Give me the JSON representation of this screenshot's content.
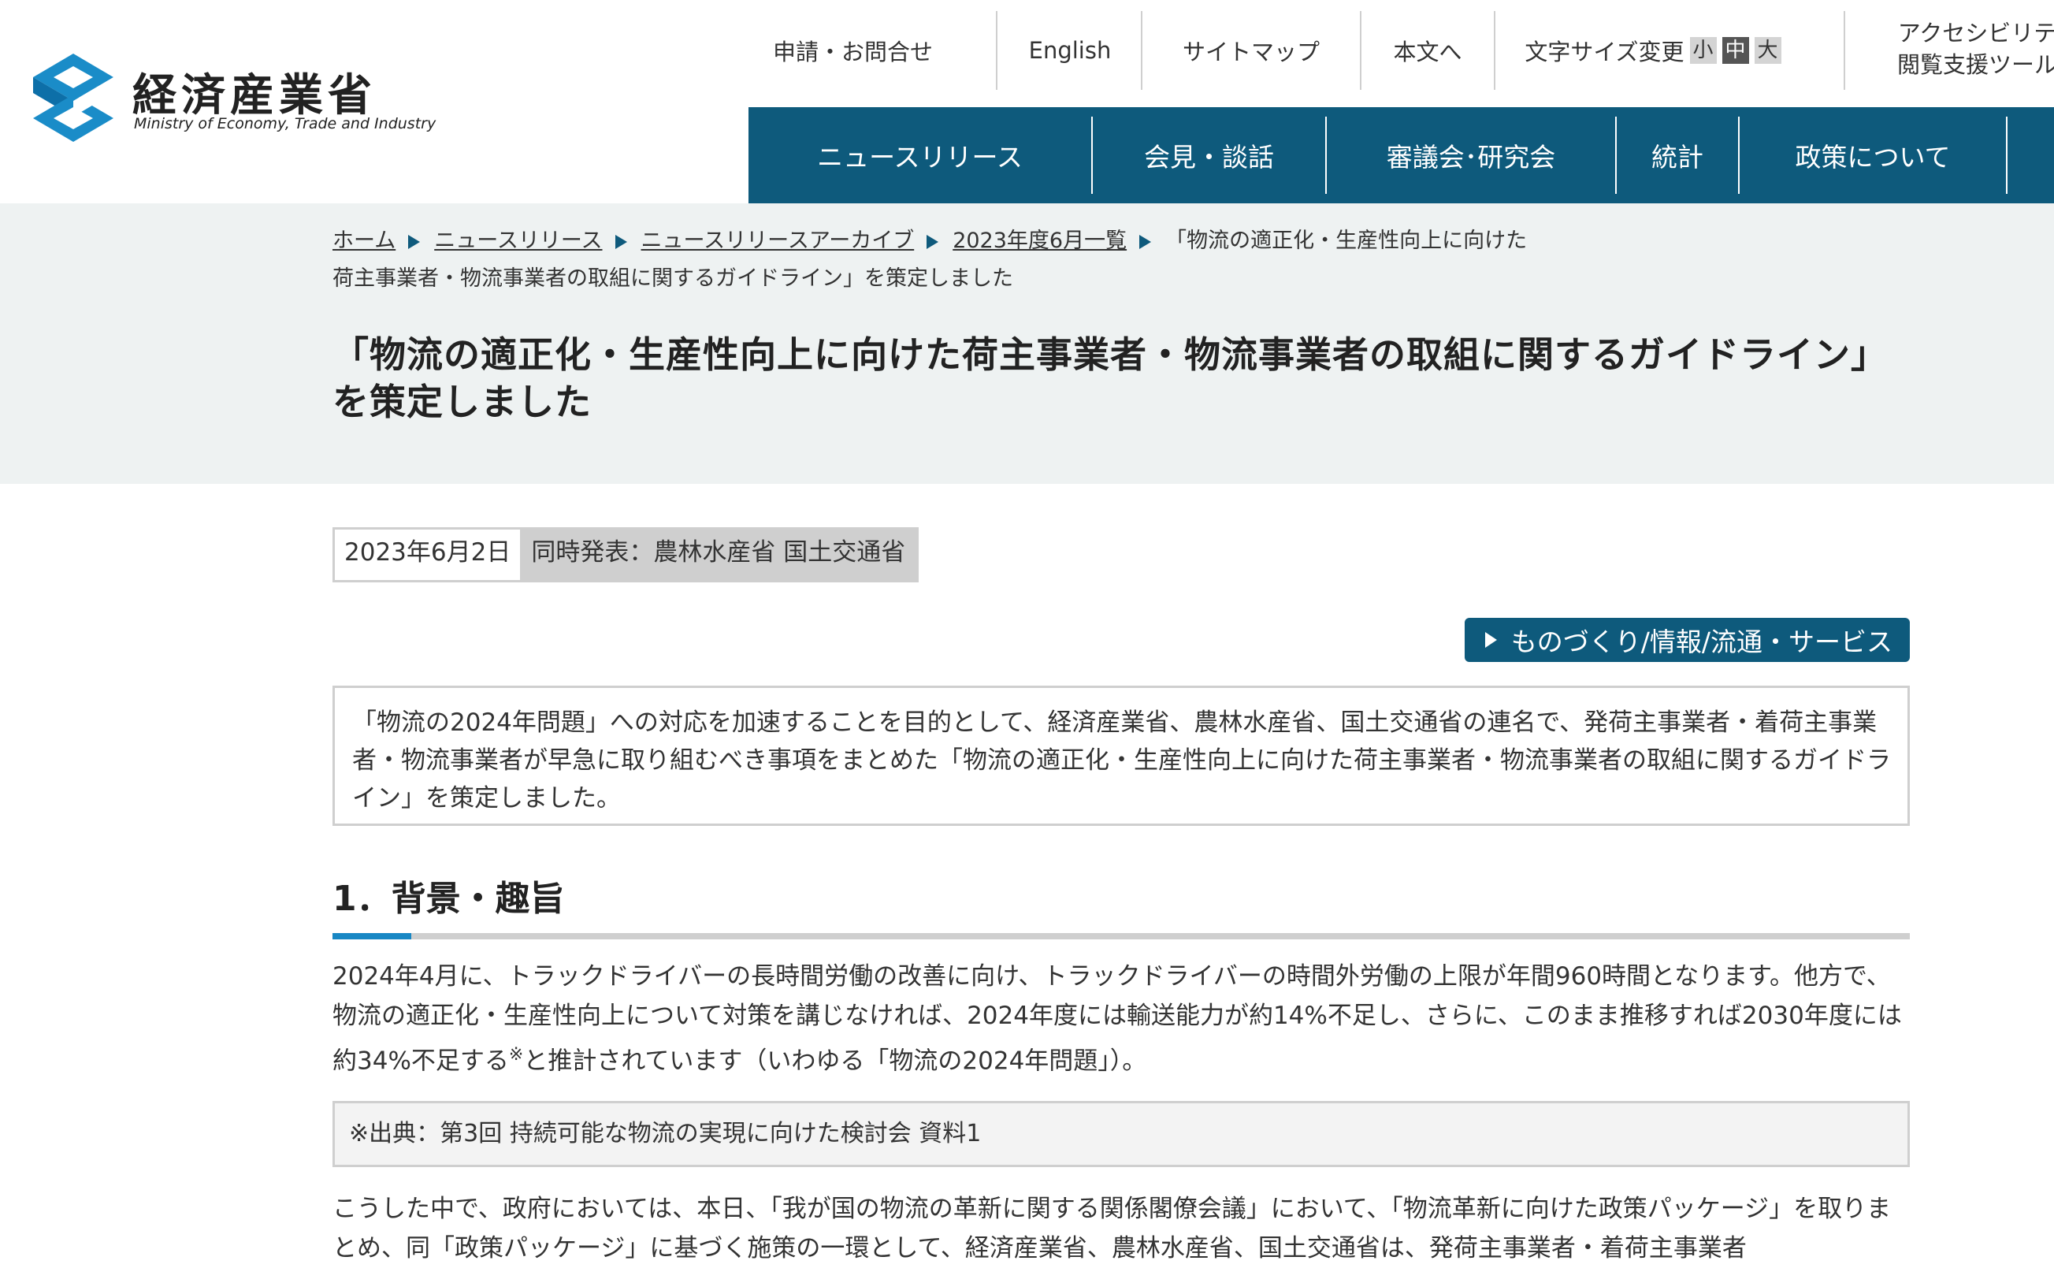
{
  "header": {
    "logo_ja": "経済産業省",
    "logo_en": "Ministry of Economy, Trade and Industry",
    "utility": {
      "contact": "申請・お問合せ",
      "english": "English",
      "sitemap": "サイトマップ",
      "to_content": "本文へ",
      "font_size_label": "文字サイズ変更",
      "font_small": "小",
      "font_mid": "中",
      "font_large": "大",
      "accessibility_line1": "アクセシビリテ",
      "accessibility_line2": "閲覧支援ツール"
    },
    "nav": [
      "ニュースリリース",
      "会見・談話",
      "審議会･研究会",
      "統計",
      "政策について"
    ]
  },
  "breadcrumb": {
    "home": "ホーム",
    "news": "ニュースリリース",
    "archive": "ニュースリリースアーカイブ",
    "month": "2023年度6月一覧",
    "current_line1": "「物流の適正化・生産性向上に向けた",
    "current_line2": "荷主事業者・物流事業者の取組に関するガイドライン」を策定しました"
  },
  "page_title": "「物流の適正化・生産性向上に向けた荷主事業者・物流事業者の取組に関するガイドライン」を策定しました",
  "meta": {
    "date": "2023年6月2日",
    "joint": "同時発表：農林水産省 国土交通省"
  },
  "category_tag": "ものづくり/情報/流通・サービス",
  "summary": "「物流の2024年問題」への対応を加速することを目的として、経済産業省、農林水産省、国土交通省の連名で、発荷主事業者・着荷主事業者・物流事業者が早急に取り組むべき事項をまとめた「物流の適正化・生産性向上に向けた荷主事業者・物流事業者の取組に関するガイドライン」を策定しました。",
  "section1": {
    "heading": "1．背景・趣旨",
    "para1_a": "2024年4月に、トラックドライバーの長時間労働の改善に向け、トラックドライバーの時間外労働の上限が年間960時間となります。他方で、物流の適正化・生産性向上について対策を講じなければ、2024年度には輸送能力が約14%不足し、さらに、このまま推移すれば2030年度には約34%不足する",
    "para1_mark": "※",
    "para1_b": "と推計されています（いわゆる「物流の2024年問題」）。",
    "note": "※出典：第3回 持続可能な物流の実現に向けた検討会 資料1",
    "para2": "こうした中で、政府においては、本日、「我が国の物流の革新に関する関係閣僚会議」において、「物流革新に向けた政策パッケージ」を取りまとめ、同「政策パッケージ」に基づく施策の一環として、経済産業省、農林水産省、国土交通省は、発荷主事業者・着荷主事業者"
  }
}
